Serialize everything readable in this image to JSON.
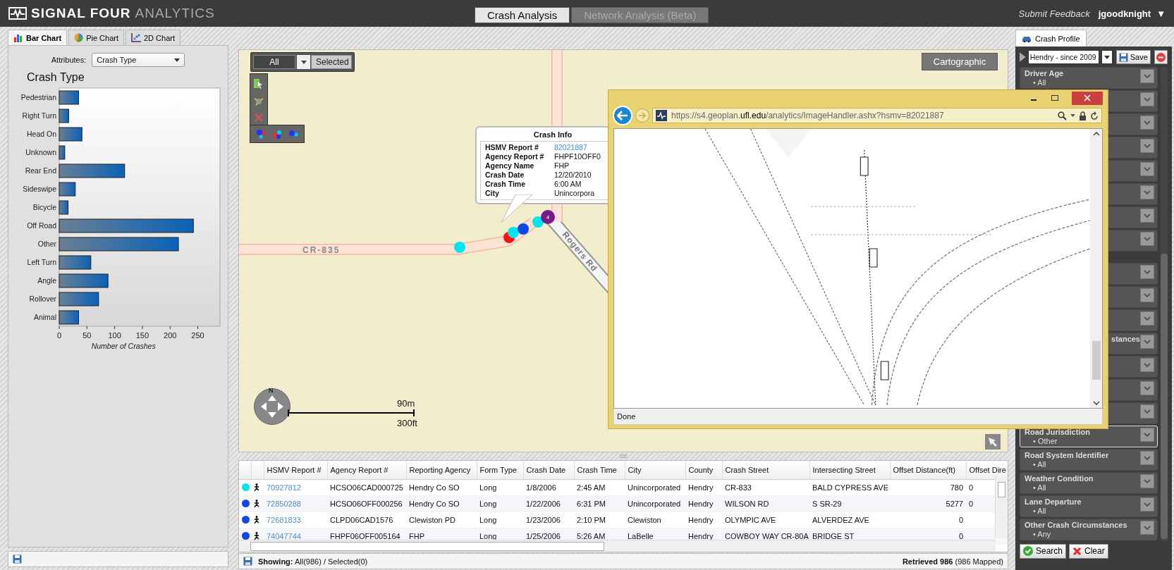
{
  "header": {
    "brand": "SIGNAL FOUR",
    "brand_suffix": "ANALYTICS",
    "tabs": [
      {
        "label": "Crash Analysis",
        "selected": true
      },
      {
        "label": "Network Analysis (Beta)",
        "selected": false
      }
    ],
    "feedback": "Submit Feedback",
    "user": "jgoodknight",
    "user_caret": "▼"
  },
  "left_panel": {
    "tabs": [
      {
        "label": "Bar Chart",
        "kind": "bar",
        "selected": true
      },
      {
        "label": "Pie Chart",
        "kind": "pie",
        "selected": false
      },
      {
        "label": "2D Chart",
        "kind": "scatter",
        "selected": false
      }
    ],
    "attributes_label": "Attributes:",
    "attribute_value": "Crash Type",
    "chart_data": {
      "type": "bar",
      "orientation": "horizontal",
      "title": "Crash Type",
      "xlabel": "Number of Crashes",
      "categories": [
        "Pedestrian",
        "Right Turn",
        "Head On",
        "Unknown",
        "Rear End",
        "Sideswipe",
        "Bicycle",
        "Off Road",
        "Other",
        "Left Turn",
        "Angle",
        "Rollover",
        "Animal"
      ],
      "values": [
        35,
        17,
        41,
        10,
        118,
        29,
        16,
        242,
        215,
        57,
        88,
        71,
        35
      ],
      "xlim": [
        0,
        290
      ],
      "xticks": [
        0,
        50,
        100,
        150,
        200,
        250
      ]
    }
  },
  "map": {
    "mode_toggle": [
      {
        "label": "All",
        "selected": true
      },
      {
        "label": "Selected",
        "selected": false
      }
    ],
    "cartographic": "Cartographic",
    "road_labels": [
      "CR-835",
      "Rogers Rd"
    ],
    "markers": [
      {
        "color": "#00e5f0"
      },
      {
        "color": "#ff1010"
      },
      {
        "color": "#00e5f0"
      },
      {
        "color": "#1048e8"
      },
      {
        "color": "#00e5f0"
      },
      {
        "color": "#7a1a88",
        "count": "4"
      }
    ],
    "popup": {
      "title": "Crash Info",
      "rows": [
        {
          "label": "HSMV Report #",
          "value": "82021887",
          "kind": "link"
        },
        {
          "label": "Agency Report #",
          "value": "FHPF10OFF0",
          "kind": "text"
        },
        {
          "label": "Agency Name",
          "value": "FHP",
          "kind": "text"
        },
        {
          "label": "Crash Date",
          "value": "12/20/2010",
          "kind": "text"
        },
        {
          "label": "Crash Time",
          "value": "6:00 AM",
          "kind": "text"
        },
        {
          "label": "City",
          "value": "Unincorpora",
          "kind": "text"
        }
      ]
    },
    "compass_north": "N",
    "scale_metric": "90m",
    "scale_imperial": "300ft"
  },
  "browser": {
    "url": "https://s4.geoplan.**ufl.edu**/analytics/ImageHandler.ashx?hsmv=82021887",
    "status": "Done"
  },
  "table": {
    "columns": [
      "HSMV Report #",
      "Agency Report #",
      "Reporting Agency",
      "Form Type",
      "Crash Date",
      "Crash Time",
      "City",
      "County",
      "Crash Street",
      "Intersecting Street",
      "Offset Distance(ft)",
      "Offset Dire"
    ],
    "rows": [
      {
        "color": "#00e5f0",
        "cells": [
          "70927812",
          "HCSO06CAD000725",
          "Hendry Co SO",
          "Long",
          "1/8/2006",
          "2:45 AM",
          "Unincorporated",
          "Hendry",
          "CR-833",
          "BALD CYPRESS AVE",
          "780",
          "0"
        ]
      },
      {
        "color": "#1048e8",
        "cells": [
          "72850288",
          "HCSO06OFF000256",
          "Hendry Co SO",
          "Long",
          "1/22/2006",
          "6:31 PM",
          "Unincorporated",
          "Hendry",
          "WILSON RD",
          "S SR-29",
          "5277",
          "0"
        ]
      },
      {
        "color": "#1048e8",
        "cells": [
          "72681833",
          "CLPD06CAD1576",
          "Clewiston PD",
          "Long",
          "1/23/2006",
          "2:10 PM",
          "Clewiston",
          "Hendry",
          "OLYMPIC AVE",
          "ALVERDEZ AVE",
          "0"
        ]
      },
      {
        "color": "#1048e8",
        "cells": [
          "74047744",
          "FHPF06OFF005164",
          "FHP",
          "Long",
          "1/25/2006",
          "5:26 AM",
          "LaBelle",
          "Hendry",
          "COWBOY WAY CR-80A",
          "BRIDGE ST",
          "0"
        ]
      }
    ],
    "showing": "**Showing:** All(986) / Selected(0)",
    "retrieved": "**Retrieved 986** (986 Mapped)"
  },
  "right_panel": {
    "tab": "Crash Profile",
    "profile": "Hendry - since 2009",
    "save": "Save",
    "filters": [
      {
        "kind": "filter",
        "label": "Driver Age",
        "value": "• All",
        "selected": false
      },
      {
        "kind": "covered",
        "selected": false
      },
      {
        "kind": "covered",
        "selected": false
      },
      {
        "kind": "covered",
        "selected": false
      },
      {
        "kind": "covered",
        "selected": false
      },
      {
        "kind": "covered",
        "selected": false
      },
      {
        "kind": "covered",
        "selected": false
      },
      {
        "kind": "covered",
        "selected": false
      },
      {
        "kind": "group"
      },
      {
        "kind": "covered",
        "selected": false
      },
      {
        "kind": "covered",
        "selected": false
      },
      {
        "kind": "covered",
        "selected": false
      },
      {
        "kind": "partial",
        "label": "stances",
        "selected": false
      },
      {
        "kind": "covered",
        "selected": false
      },
      {
        "kind": "covered",
        "selected": false
      },
      {
        "kind": "covered",
        "selected": false
      },
      {
        "kind": "filter",
        "label": "Road Jurisdiction",
        "value": "• Other",
        "selected": true
      },
      {
        "kind": "filter",
        "label": "Road System Identifier",
        "value": "• All",
        "selected": false
      },
      {
        "kind": "filter",
        "label": "Weather Condition",
        "value": "• All",
        "selected": false
      },
      {
        "kind": "filter",
        "label": "Lane Departure",
        "value": "• All",
        "selected": false
      },
      {
        "kind": "filter",
        "label": "Other Crash Circumstances",
        "value": "• Any",
        "selected": false
      }
    ],
    "search": "Search",
    "clear": "Clear"
  }
}
